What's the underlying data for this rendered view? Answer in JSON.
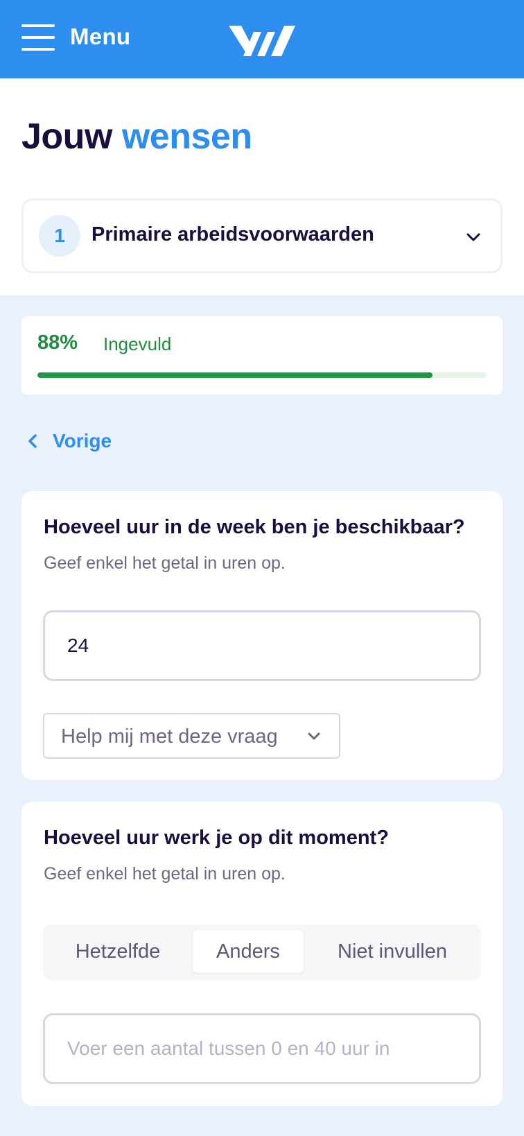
{
  "header": {
    "menu_label": "Menu",
    "brand_color": "#2e8ef0"
  },
  "title": {
    "part1": "Jouw",
    "part2": "wensen"
  },
  "section": {
    "step_number": "1",
    "name": "Primaire arbeidsvoorwaarden"
  },
  "progress": {
    "percent_label": "88%",
    "status_label": "Ingevuld",
    "value": 0.88,
    "color": "#1e9a45"
  },
  "nav": {
    "back_label": "Vorige"
  },
  "question1": {
    "title": "Hoeveel uur in de week ben je beschikbaar?",
    "subtitle": "Geef enkel het getal in uren op.",
    "value": "24",
    "help_label": "Help mij met deze vraag"
  },
  "question2": {
    "title": "Hoeveel uur werk je op dit moment?",
    "subtitle": "Geef enkel het getal in uren op.",
    "options": [
      "Hetzelfde",
      "Anders",
      "Niet invullen"
    ],
    "selected": "Anders",
    "placeholder": "Voer een aantal tussen 0 en 40 uur in"
  }
}
